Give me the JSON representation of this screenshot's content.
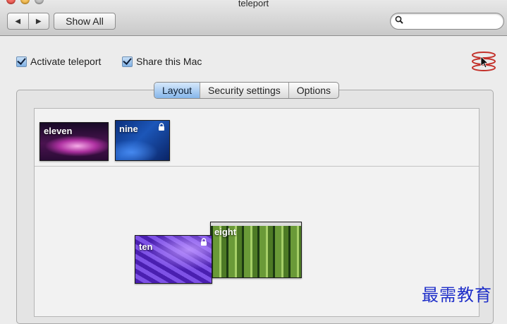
{
  "window": {
    "title": "teleport"
  },
  "toolbar": {
    "back_glyph": "◀",
    "forward_glyph": "▶",
    "show_all_label": "Show All",
    "search": {
      "value": "",
      "placeholder": ""
    }
  },
  "options": {
    "activate": {
      "label": "Activate teleport",
      "checked": true
    },
    "share": {
      "label": "Share this Mac",
      "checked": true
    }
  },
  "tabs": [
    {
      "label": "Layout",
      "selected": true
    },
    {
      "label": "Security settings",
      "selected": false
    },
    {
      "label": "Options",
      "selected": false
    }
  ],
  "layout": {
    "available_screens": [
      {
        "name": "eleven",
        "locked": false
      },
      {
        "name": "nine",
        "locked": true
      }
    ],
    "arranged_screens": [
      {
        "name": "eight",
        "locked": false
      },
      {
        "name": "ten",
        "locked": true
      }
    ]
  },
  "watermark": "最需教育",
  "colors": {
    "accent": "#86b6ea",
    "watermark": "#1f2fc9"
  }
}
